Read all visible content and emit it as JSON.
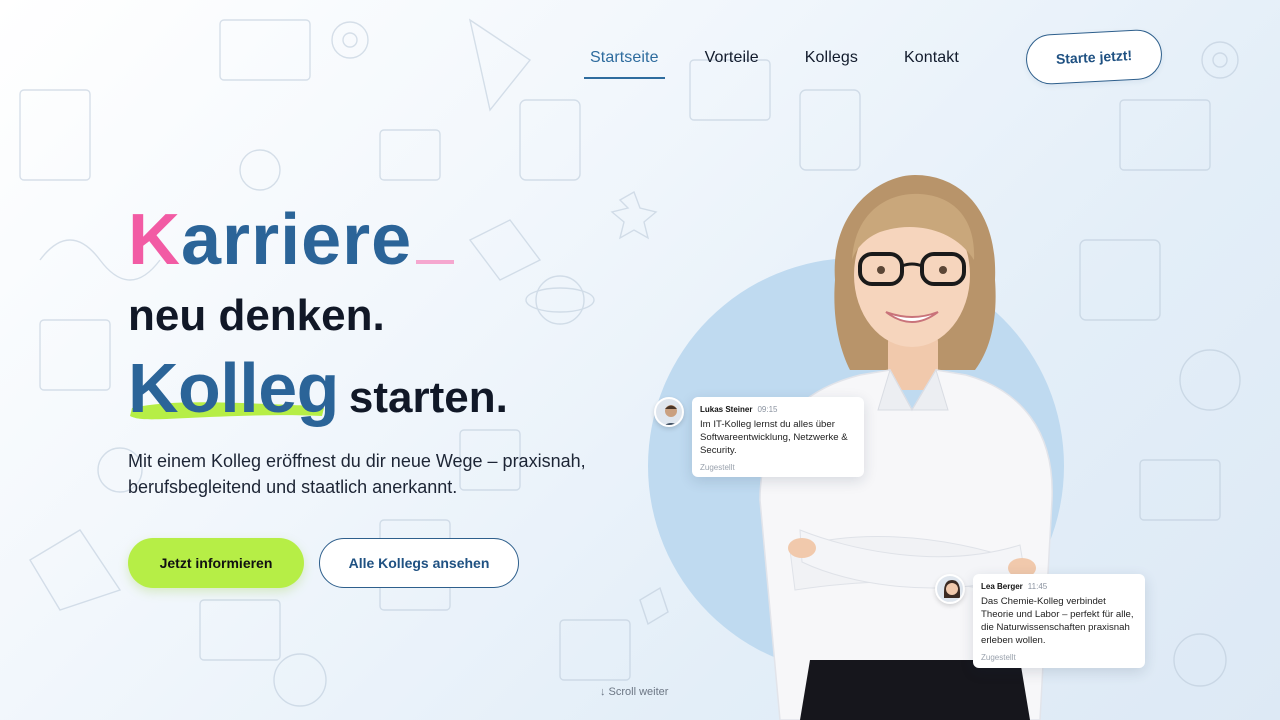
{
  "nav": {
    "items": [
      "Startseite",
      "Vorteile",
      "Kollegs",
      "Kontakt"
    ],
    "active": "Startseite",
    "cta_label": "Starte jetzt!"
  },
  "hero": {
    "line1_first": "K",
    "line1_rest": "arriere",
    "line2": "neu denken.",
    "line3_highlight": "Kolleg",
    "line3_rest": "starten.",
    "description": "Mit einem Kolleg eröffnest du dir neue Wege – praxisnah, berufsbegleitend und staatlich anerkannt."
  },
  "buttons": {
    "primary_label": "Jetzt informieren",
    "secondary_label": "Alle Kollegs ansehen"
  },
  "chats": [
    {
      "name": "Lukas Steiner",
      "time": "09:15",
      "message": "Im IT-Kolleg lernst du alles über Softwareentwicklung, Netzwerke & Security.",
      "status": "Zugestellt"
    },
    {
      "name": "Lea Berger",
      "time": "11:45",
      "message": "Das Chemie-Kolleg verbindet Theorie und Labor – perfekt für alle, die Naturwissenschaften praxisnah erleben wollen.",
      "status": "Zugestellt"
    }
  ],
  "scroll_hint": "↓ Scroll weiter",
  "colors": {
    "accent_blue": "#2b6498",
    "accent_pink": "#f25ba4",
    "accent_green": "#b6ee46",
    "circle_bg": "#bfdaf0"
  }
}
